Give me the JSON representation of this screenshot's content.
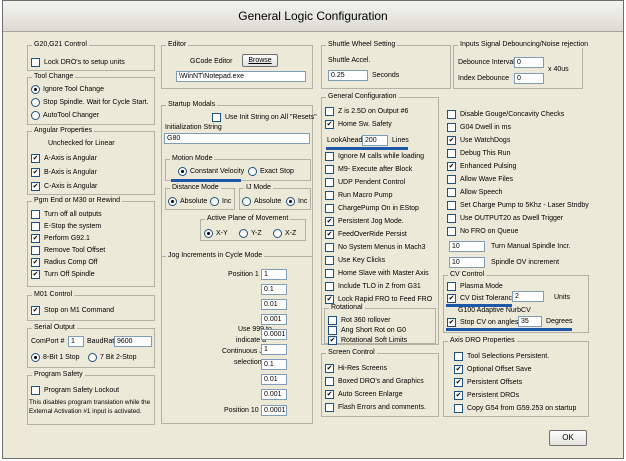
{
  "window": {
    "title": "General Logic Configuration"
  },
  "g20": {
    "title": "G20,G21 Control",
    "lock_label": "Lock DRO's to setup units"
  },
  "toolchange": {
    "title": "Tool Change",
    "options": [
      "Ignore Tool Change",
      "Stop Spindle. Wait for Cycle Start.",
      "AutoTool Changer"
    ]
  },
  "angular": {
    "title": "Angular Properties",
    "note": "Unchecked for Linear",
    "items": [
      "A-Axis is Angular",
      "B-Axis is Angular",
      "C-Axis is Angular"
    ]
  },
  "pgm": {
    "title": "Pgm End or M30 or Rewind",
    "items": [
      "Turn off all outputs",
      "E-Stop the system",
      "Perform G92.1",
      "Remove Tool Offset",
      "Radius Comp Off",
      "Turn Off Spindle"
    ]
  },
  "m01": {
    "title": "M01 Control",
    "label": "Stop on M1 Command"
  },
  "serial": {
    "title": "Serial Output",
    "comport_label": "ComPort #",
    "comport_value": "1",
    "baud_label": "BaudRate",
    "baud_value": "9600",
    "options": [
      "8-Bit 1 Stop",
      "7 Bit 2-Stop"
    ]
  },
  "safety": {
    "title": "Program Safety",
    "label": "Program Safety Lockout",
    "note1": "This disables program translation while the",
    "note2": "External Activation #1 input is activated."
  },
  "editor": {
    "title": "Editor",
    "label": "GCode Editor",
    "browse": "Browse",
    "path": "\\WinNT\\Notepad.exe"
  },
  "startup": {
    "title": "Startup Modals",
    "init_all_label": "Use Init String on All \"Resets\"",
    "init_label": "Initialization String",
    "init_value": "G80"
  },
  "motion": {
    "title": "Motion Mode",
    "options": [
      "Constant Velocity",
      "Exact Stop"
    ]
  },
  "distance": {
    "title": "Distance Mode",
    "options": [
      "Absolute",
      "Inc"
    ]
  },
  "ij": {
    "title": "IJ Mode",
    "options": [
      "Absolute",
      "Inc"
    ]
  },
  "plane": {
    "title": "Active Plane of Movement",
    "options": [
      "X-Y",
      "Y-Z",
      "X-Z"
    ]
  },
  "jog": {
    "title": "Jog Increments in Cycle Mode",
    "pos1": "Position 1",
    "pos10": "Position 10",
    "note": [
      "Use 999 to",
      "indicate a",
      "Continuous Jog",
      "selection."
    ],
    "values": [
      "1",
      "0.1",
      "0.01",
      "0.001",
      "0.0001",
      "1",
      "0.1",
      "0.01",
      "0.001",
      "0.0001"
    ]
  },
  "shuttle": {
    "title": "Shuttle Wheel Setting",
    "accel_label": "Shuttle Accel.",
    "accel_value": "0.25",
    "unit": "Seconds"
  },
  "debounce": {
    "title": "Inputs Signal Debouncing/Noise rejection",
    "interval_label": "Debounce Interval",
    "interval_value": "0",
    "index_label": "Index Debounce",
    "index_value": "0",
    "unit": "x 40us"
  },
  "general": {
    "title": "General Configuration",
    "left": [
      {
        "label": "Z is 2.5D on Output #6",
        "checked": false
      },
      {
        "label": "Home Sw. Safety",
        "checked": true
      },
      {
        "label": "LookAhead",
        "checked": null
      },
      {
        "label": "Ignore M calls while loading",
        "checked": false
      },
      {
        "label": "M9- Execute after Block",
        "checked": false
      },
      {
        "label": "UDP Pendent Control",
        "checked": false
      },
      {
        "label": "Run Macro Pump",
        "checked": false
      },
      {
        "label": "ChargePump On in EStop",
        "checked": false
      },
      {
        "label": "Persistent Jog Mode.",
        "checked": true
      },
      {
        "label": "FeedOverRide Persist",
        "checked": true
      },
      {
        "label": "No System Menus in Mach3",
        "checked": false
      },
      {
        "label": "Use Key Clicks",
        "checked": false
      },
      {
        "label": "Home Slave with Master Axis",
        "checked": false
      },
      {
        "label": "Include TLO in Z from G31",
        "checked": false
      },
      {
        "label": "Lock Rapid FRO to Feed FRO",
        "checked": true
      }
    ],
    "lookahead_value": "200",
    "lookahead_unit": "Lines",
    "right": [
      {
        "label": "Disable Gouge/Concavity Checks",
        "checked": false
      },
      {
        "label": "G04 Dwell in ms",
        "checked": false
      },
      {
        "label": "Use WatchDogs",
        "checked": true
      },
      {
        "label": "Debug This Run",
        "checked": false
      },
      {
        "label": "Enhanced Pulsing",
        "checked": true
      },
      {
        "label": "Allow Wave Files",
        "checked": false
      },
      {
        "label": "Allow Speech",
        "checked": false
      },
      {
        "label": "Set Charge Pump to 5Khz - Laser Stndby",
        "checked": false
      },
      {
        "label": "Use OUTPUT20 as Dwell Trigger",
        "checked": false
      },
      {
        "label": "No FRO on Queue",
        "checked": false
      }
    ],
    "spindle_inc_value": "10",
    "spindle_inc_label": "Turn Manual Spindle Incr.",
    "spindle_ov_value": "10",
    "spindle_ov_label": "Spindle OV increment"
  },
  "rotational": {
    "title": "Rotational",
    "items": [
      {
        "label": "Rot 360 rollover",
        "checked": false
      },
      {
        "label": "Ang Short Rot on G0",
        "checked": false
      },
      {
        "label": "Rotational Soft Limits",
        "checked": true
      }
    ]
  },
  "cv": {
    "title": "CV Control",
    "plasma": "Plasma Mode",
    "dist_label": "CV Dist Tolerance",
    "dist_value": "2",
    "dist_unit": "Units",
    "g100": "G100 Adaptive NurbCV",
    "stop_label": "Stop CV on angles >",
    "stop_value": "35",
    "stop_unit": "Degrees"
  },
  "screen": {
    "title": "Screen Control",
    "items": [
      {
        "label": "Hi-Res Screens",
        "checked": true
      },
      {
        "label": "Boxed DRO's and Graphics",
        "checked": false
      },
      {
        "label": "Auto Screen Enlarge",
        "checked": true
      },
      {
        "label": "Flash Errors and comments.",
        "checked": false
      }
    ]
  },
  "axisdro": {
    "title": "Axis DRO Properties",
    "items": [
      {
        "label": "Tool Selections Persistent.",
        "checked": false
      },
      {
        "label": "Optional Offset Save",
        "checked": true
      },
      {
        "label": "Persistent Offsets",
        "checked": true
      },
      {
        "label": "Persistent DROs",
        "checked": true
      },
      {
        "label": "Copy G54 from G59.253 on startup",
        "checked": false
      }
    ]
  },
  "ok": "OK",
  "colors": {
    "highlight": "#1f57a8",
    "dialog_bg": "#ece9d8"
  }
}
